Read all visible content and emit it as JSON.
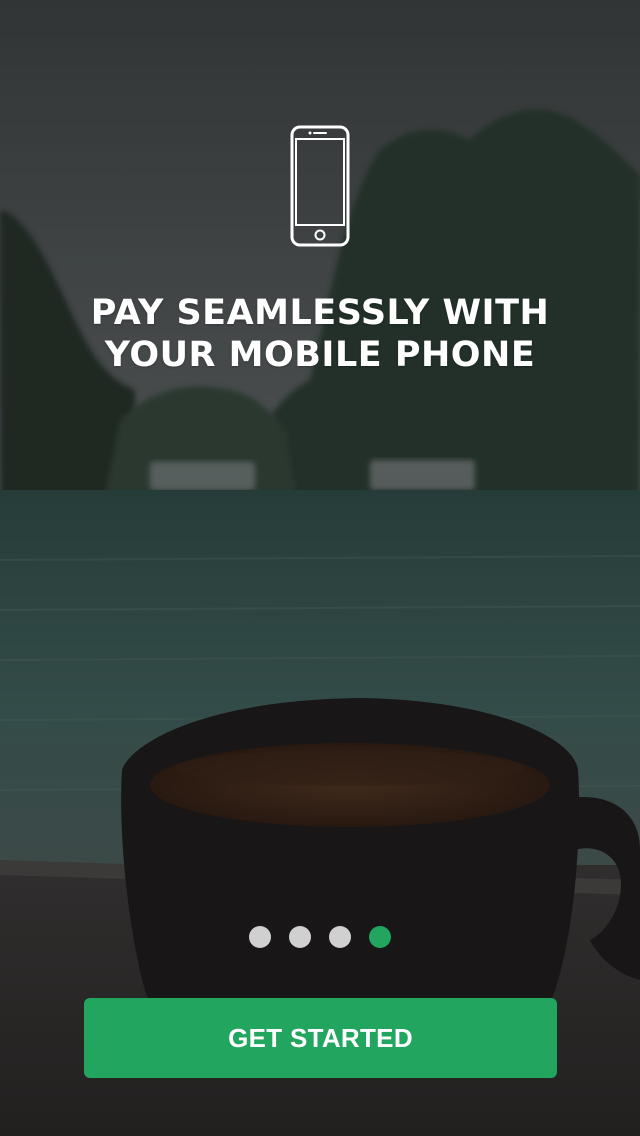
{
  "onboarding": {
    "headline_line_1": "PAY SEAMLESSLY WITH",
    "headline_line_2": "YOUR MOBILE PHONE",
    "icon": "smartphone-icon",
    "background_image": "blurred photo of a coffee cup in front of a bay with karst mountains"
  },
  "pager": {
    "total": 4,
    "current": 4,
    "active_color": "#22a55e",
    "inactive_color": "#d0d0d0"
  },
  "cta": {
    "label": "GET STARTED",
    "color": "#22a55e"
  }
}
